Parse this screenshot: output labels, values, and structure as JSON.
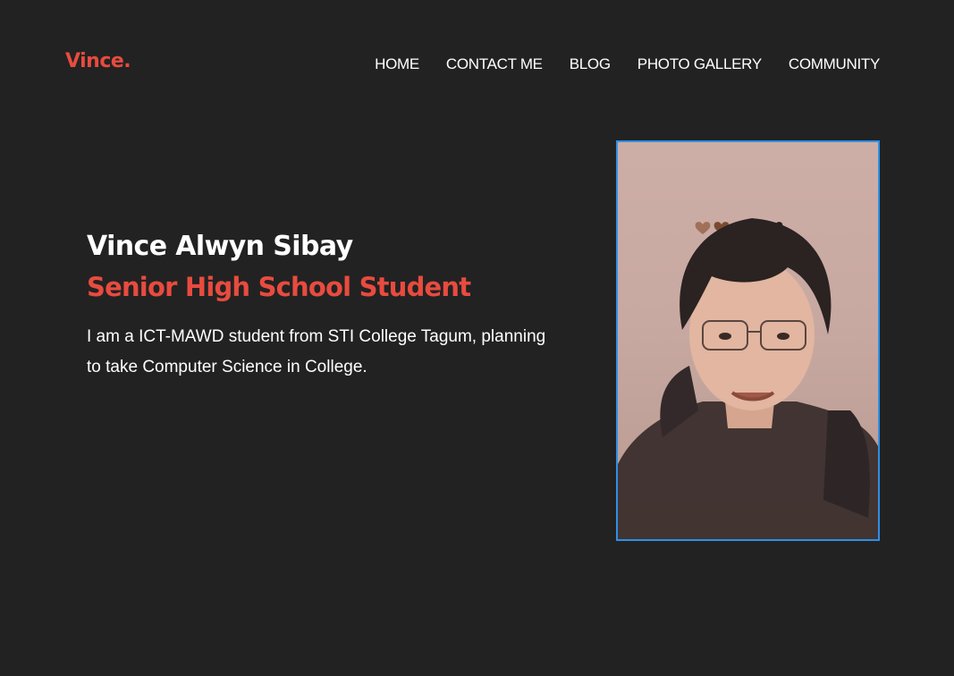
{
  "brand": {
    "logo_text": "Vince."
  },
  "nav": {
    "items": [
      {
        "label": "HOME"
      },
      {
        "label": "CONTACT ME"
      },
      {
        "label": "BLOG"
      },
      {
        "label": "PHOTO GALLERY"
      },
      {
        "label": "COMMUNITY"
      }
    ]
  },
  "hero": {
    "name": "Vince Alwyn Sibay",
    "role": "Senior High School Student",
    "description": "I am a ICT-MAWD student from STI College Tagum, planning to take Computer Science in College."
  },
  "colors": {
    "background": "#222222",
    "accent": "#e84b3f",
    "text": "#ffffff",
    "photo_border": "#2f8fe6"
  }
}
